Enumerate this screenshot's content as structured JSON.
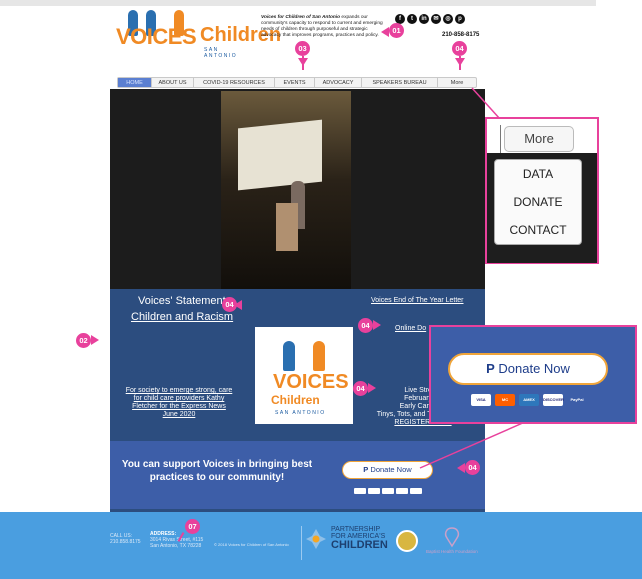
{
  "header": {
    "logo_voices": "VOICES",
    "logo_children": "Children",
    "logo_sub": "SAN ANTONIO",
    "desc_org": "Voices for Children of San Antonio",
    "desc_text": " expands our community's capacity to respond to current and emerging needs of children through purposeful and strategic advocacy that improves programs, practices and policy.",
    "social": [
      "f",
      "t",
      "in",
      "✉",
      "◎",
      "p"
    ],
    "phone": "210-858-8175"
  },
  "nav": [
    "HOME",
    "ABOUT US",
    "COVID-19 RESOURCES",
    "EVENTS",
    "ADVOCACY",
    "SPEAKERS BUREAU",
    "More"
  ],
  "main": {
    "statement_title": "Voices' Statement",
    "statement_link": "Children and Racism",
    "letter_link": "Voices End of The Year Letter",
    "online_link": "Online Do",
    "article_link": "For society to emerge strong, care for child care providers Kathy Fletcher for the Express News June 2020",
    "livestream_l1": "Live Stream",
    "livestream_l2": "February 27",
    "livestream_l3": "Early Care and",
    "livestream_l4": "Tinys, Tots, and Teens, 0-Fifty",
    "livestream_link": "REGISTER HERE"
  },
  "support": {
    "text": "You can support Voices in bringing best practices to our community!",
    "donate_label": "Donate Now"
  },
  "footer": {
    "call_label": "CALL US:",
    "call_phone": "210.858.8175",
    "address_label": "ADDRESS:",
    "address_line1": "3014 Rivas Street, #115",
    "address_line2": "San Antonio, TX 78228",
    "copyright": "© 2018 Voices for Children of San Antonio",
    "pfac_l1": "PARTNERSHIP",
    "pfac_l2": "FOR AMERICA'S",
    "pfac_l3": "CHILDREN",
    "baptist": "Baptist Health Foundation"
  },
  "callouts": [
    "01",
    "02",
    "03",
    "04",
    "04",
    "04",
    "04",
    "04",
    "07"
  ],
  "zoom_more": {
    "tab": "More",
    "items": [
      "DATA",
      "DONATE",
      "CONTACT"
    ]
  },
  "zoom_donate": {
    "label": "Donate Now",
    "cards": [
      "VISA",
      "MC",
      "AMEX",
      "DISCOVER",
      "PayPal"
    ]
  },
  "colors": {
    "accent_pink": "#e8419c",
    "brand_orange": "#f08a24",
    "navy": "#2c4d7f",
    "footer_blue": "#4a9ee0"
  }
}
